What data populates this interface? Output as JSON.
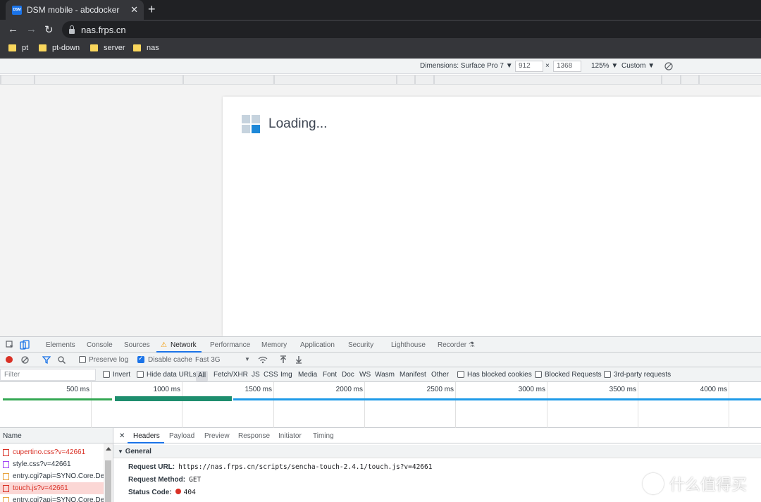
{
  "browser": {
    "tab_favicon": "DSM",
    "tab_title": "DSM mobile - abcdocker",
    "tab_close": "✕",
    "new_tab": "+",
    "back": "←",
    "forward": "→",
    "reload": "↻",
    "url": "nas.frps.cn",
    "bookmarks": [
      "pt",
      "pt-down",
      "server",
      "nas"
    ]
  },
  "device_toolbar": {
    "dimensions_label": "Dimensions: Surface Pro 7",
    "width": "912",
    "times": "×",
    "height": "1368",
    "zoom": "125%",
    "throttle": "Custom",
    "dropdown_arrow": "▼"
  },
  "page": {
    "loading_text": "Loading...",
    "logo_colors": [
      "#c6d3de",
      "#c6d3de",
      "#c6d3de",
      "#1e88d8"
    ]
  },
  "devtools": {
    "tabs": [
      "Elements",
      "Console",
      "Sources",
      "Network",
      "Performance",
      "Memory",
      "Application",
      "Security",
      "Lighthouse",
      "Recorder"
    ],
    "warning_icon": "⚠",
    "recorder_icon": "⚗",
    "network_toolbar": {
      "preserve_log": "Preserve log",
      "disable_cache": "Disable cache",
      "throttling": "Fast 3G"
    },
    "filter": {
      "placeholder": "Filter",
      "invert": "Invert",
      "hide_data_urls": "Hide data URLs",
      "types": [
        "All",
        "Fetch/XHR",
        "JS",
        "CSS",
        "Img",
        "Media",
        "Font",
        "Doc",
        "WS",
        "Wasm",
        "Manifest",
        "Other"
      ],
      "has_blocked_cookies": "Has blocked cookies",
      "blocked_requests": "Blocked Requests",
      "third_party": "3rd-party requests"
    },
    "timeline_ticks": [
      "500 ms",
      "1000 ms",
      "1500 ms",
      "2000 ms",
      "2500 ms",
      "3000 ms",
      "3500 ms",
      "4000 ms"
    ],
    "requests_header": "Name",
    "requests": [
      {
        "name": "cupertino.css?v=42661",
        "color": "#d93025",
        "icon_color": "#d93025",
        "highlight": false
      },
      {
        "name": "style.css?v=42661",
        "color": "#303942",
        "icon_color": "#a142f4",
        "highlight": false
      },
      {
        "name": "entry.cgi?api=SYNO.Core.Desktop",
        "color": "#303942",
        "icon_color": "#e8a33c",
        "highlight": false
      },
      {
        "name": "touch.js?v=42661",
        "color": "#d93025",
        "icon_color": "#d93025",
        "highlight": true
      },
      {
        "name": "entry.cgi?api=SYNO.Core.Desktop",
        "color": "#303942",
        "icon_color": "#e8a33c",
        "highlight": false
      }
    ],
    "detail_tabs": [
      "Headers",
      "Payload",
      "Preview",
      "Response",
      "Initiator",
      "Timing"
    ],
    "close_icon": "✕",
    "general_label": "General",
    "headers": {
      "request_url_key": "Request URL:",
      "request_url": "https://nas.frps.cn/scripts/sencha-touch-2.4.1/touch.js?v=42661",
      "method_key": "Request Method:",
      "method": "GET",
      "status_key": "Status Code:",
      "status": "404"
    }
  },
  "watermark": "什么值得买"
}
